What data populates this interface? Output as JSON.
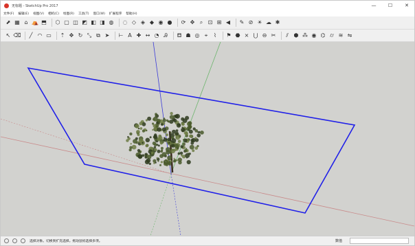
{
  "window": {
    "title": "无标题 - SketchUp Pro 2017",
    "minimize": "—",
    "maximize": "☐",
    "close": "✕"
  },
  "menu": [
    "文件(F)",
    "编辑(E)",
    "视图(V)",
    "相机(C)",
    "绘图(R)",
    "工具(T)",
    "窗口(W)",
    "扩展程序",
    "帮助(H)"
  ],
  "toolbar1": [
    {
      "icon": "select-arrow-icon",
      "glyph": "⬈"
    },
    {
      "icon": "component-icon",
      "glyph": "▦"
    },
    {
      "icon": "house-icon",
      "glyph": "⌂"
    },
    {
      "icon": "warehouse-icon",
      "glyph": "⛺"
    },
    {
      "icon": "extension-warehouse-icon",
      "glyph": "⬒"
    },
    {
      "icon": "iso-view-icon",
      "glyph": "⬡"
    },
    {
      "icon": "top-view-icon",
      "glyph": "▢"
    },
    {
      "icon": "front-view-icon",
      "glyph": "◫"
    },
    {
      "icon": "right-view-icon",
      "glyph": "◩"
    },
    {
      "icon": "back-view-icon",
      "glyph": "◧"
    },
    {
      "icon": "left-view-icon",
      "glyph": "◨"
    },
    {
      "icon": "xray-icon",
      "glyph": "◍"
    },
    {
      "icon": "back-edges-icon",
      "glyph": "◌"
    },
    {
      "icon": "wireframe-icon",
      "glyph": "◇"
    },
    {
      "icon": "hidden-line-icon",
      "glyph": "◈"
    },
    {
      "icon": "shaded-icon",
      "glyph": "◆"
    },
    {
      "icon": "shaded-texture-icon",
      "glyph": "◉"
    },
    {
      "icon": "monochrome-icon",
      "glyph": "●"
    },
    {
      "icon": "orbit-icon",
      "glyph": "⟳"
    },
    {
      "icon": "pan-icon",
      "glyph": "✥"
    },
    {
      "icon": "zoom-icon",
      "glyph": "⌕"
    },
    {
      "icon": "zoom-window-icon",
      "glyph": "⊡"
    },
    {
      "icon": "zoom-extents-icon",
      "glyph": "⊞"
    },
    {
      "icon": "previous-view-icon",
      "glyph": "◀"
    },
    {
      "icon": "style-icon",
      "glyph": "✎"
    },
    {
      "icon": "section-plane-icon",
      "glyph": "⊘"
    },
    {
      "icon": "shadow-icon",
      "glyph": "☀"
    },
    {
      "icon": "fog-icon",
      "glyph": "☁"
    },
    {
      "icon": "settings-icon",
      "glyph": "✱"
    }
  ],
  "toolbar2": [
    {
      "icon": "select-icon",
      "glyph": "↖"
    },
    {
      "icon": "eraser-icon",
      "glyph": "⌫"
    },
    {
      "icon": "line-icon",
      "glyph": "╱"
    },
    {
      "icon": "arc-icon",
      "glyph": "◠"
    },
    {
      "icon": "rectangle-icon",
      "glyph": "▭"
    },
    {
      "icon": "push-pull-icon",
      "glyph": "⇡"
    },
    {
      "icon": "move-icon",
      "glyph": "✥"
    },
    {
      "icon": "rotate-icon",
      "glyph": "↻"
    },
    {
      "icon": "scale-icon",
      "glyph": "⤡"
    },
    {
      "icon": "offset-icon",
      "glyph": "⧉"
    },
    {
      "icon": "follow-me-icon",
      "glyph": "➤"
    },
    {
      "icon": "tape-measure-icon",
      "glyph": "⊢"
    },
    {
      "icon": "text-icon",
      "glyph": "A"
    },
    {
      "icon": "axes-icon",
      "glyph": "✚"
    },
    {
      "icon": "dimension-icon",
      "glyph": "↔"
    },
    {
      "icon": "protractor-icon",
      "glyph": "◔"
    },
    {
      "icon": "3d-text-icon",
      "glyph": "Ꭿ"
    },
    {
      "icon": "paint-bucket-icon",
      "glyph": "⛾"
    },
    {
      "icon": "walk-icon",
      "glyph": "☗"
    },
    {
      "icon": "look-around-icon",
      "glyph": "◎"
    },
    {
      "icon": "position-camera-icon",
      "glyph": "⌖"
    },
    {
      "icon": "sandbox-icon",
      "glyph": "⌇"
    },
    {
      "icon": "add-location-icon",
      "glyph": "⚑"
    },
    {
      "icon": "solid-tools-icon",
      "glyph": "⬣"
    },
    {
      "icon": "intersect-icon",
      "glyph": "⨯"
    },
    {
      "icon": "union-icon",
      "glyph": "⋃"
    },
    {
      "icon": "subtract-icon",
      "glyph": "⊖"
    },
    {
      "icon": "trim-icon",
      "glyph": "✂"
    },
    {
      "icon": "split-icon",
      "glyph": "⫽"
    },
    {
      "icon": "outer-shell-icon",
      "glyph": "⬢"
    },
    {
      "icon": "footprints-icon",
      "glyph": "⁂"
    },
    {
      "icon": "eye-icon",
      "glyph": "◉"
    },
    {
      "icon": "stamp-icon",
      "glyph": "⌬"
    },
    {
      "icon": "drape-icon",
      "glyph": "⌭"
    },
    {
      "icon": "smoove-icon",
      "glyph": "≋"
    },
    {
      "icon": "flip-edge-icon",
      "glyph": "⇋"
    }
  ],
  "status": {
    "text": "选择对象。切换到扩充选择。拖动鼠标选择多项。",
    "measure_label": "数值",
    "measure_value": ""
  },
  "scene": {
    "background": "#d2d2cf",
    "axis_red": "#c98a8a",
    "axis_green": "#6cb56c",
    "axis_blue": "#3a3ad8",
    "selection_outline": "#2020e8",
    "tree_dark": "#2f3b1e",
    "tree_mid": "#4a5a2c",
    "tree_light": "#6f7d45"
  }
}
